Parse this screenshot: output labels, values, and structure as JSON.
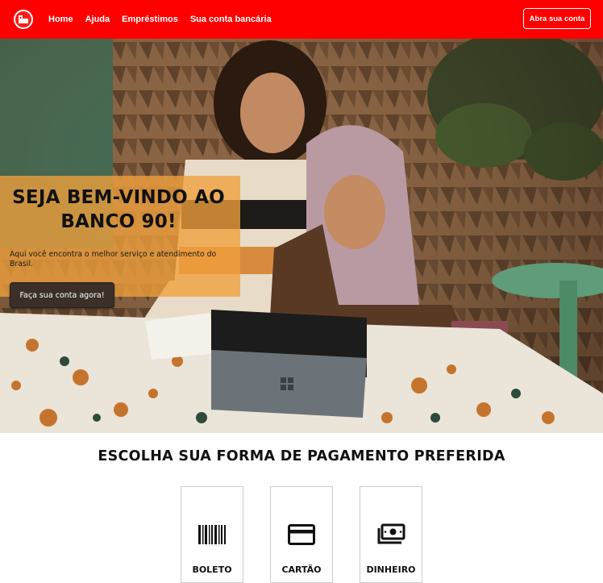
{
  "navbar": {
    "logo_icon": "bank-building-icon",
    "links": [
      "Home",
      "Ajuda",
      "Empréstimos",
      "Sua conta bancária"
    ],
    "open_account_label": "Abra sua conta",
    "background_color": "#ff0000"
  },
  "hero": {
    "title": "SEJA BEM-VINDO AO BANCO 90!",
    "subtitle": "Aqui você encontra o melhor serviço e atendimento do Brasil.",
    "cta_label": "Faça sua conta agora!",
    "card_color": "#f0a03c"
  },
  "payment": {
    "title": "ESCOLHA SUA FORMA DE PAGAMENTO PREFERIDA",
    "options": [
      {
        "label": "BOLETO",
        "icon": "barcode-icon"
      },
      {
        "label": "CARTÃO",
        "icon": "credit-card-icon"
      },
      {
        "label": "DINHEIRO",
        "icon": "cash-icon"
      }
    ]
  }
}
